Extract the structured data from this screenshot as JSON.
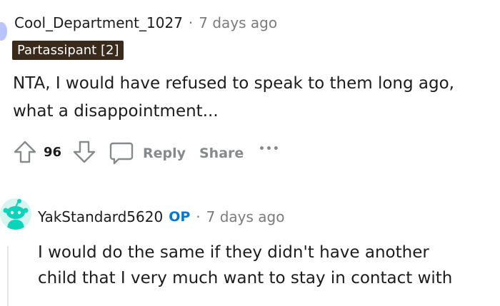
{
  "comment_1": {
    "username": "Cool_Department_1027",
    "separator": "·",
    "timestamp": "7 days ago",
    "flair": "Partassipant [2]",
    "body_lines": [
      "NTA, I would have refused to speak to them long ago,",
      "what a disappointment..."
    ],
    "vote_count": "96",
    "reply_label": "Reply",
    "share_label": "Share",
    "more_label": "•••"
  },
  "comment_2": {
    "username": "YakStandard5620",
    "op_badge": "OP",
    "separator": "·",
    "timestamp": "7 days ago",
    "body_lines": [
      "I would do the same if they didn't have another",
      "child that I very much want to stay in contact with"
    ]
  },
  "colors": {
    "flair_bg": "#3a2a1c",
    "op_blue": "#0079d3",
    "avatar_teal": "#0dd3bb",
    "meta_gray": "#7c7c7c",
    "action_gray": "#878a8c"
  },
  "icons": [
    "upvote-icon",
    "downvote-icon",
    "comment-icon",
    "more-icon",
    "snoo-avatar-icon"
  ]
}
